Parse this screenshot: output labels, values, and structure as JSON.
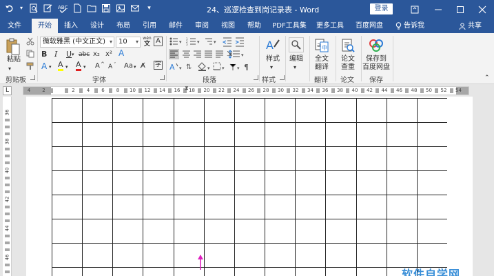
{
  "titlebar": {
    "doc_title": "24、巡逻检查到岗记录表 - Word",
    "login_label": "登录",
    "qat_icons": [
      "undo-icon",
      "redo-icon",
      "print-preview-icon",
      "format-painter-icon",
      "spellcheck-icon",
      "new-doc-icon",
      "open-folder-icon",
      "save-icon",
      "photo-icon",
      "email-icon",
      "qat-more-icon"
    ]
  },
  "tabs": {
    "items": [
      {
        "label": "文件"
      },
      {
        "label": "开始"
      },
      {
        "label": "插入"
      },
      {
        "label": "设计"
      },
      {
        "label": "布局"
      },
      {
        "label": "引用"
      },
      {
        "label": "邮件"
      },
      {
        "label": "审阅"
      },
      {
        "label": "视图"
      },
      {
        "label": "帮助"
      },
      {
        "label": "PDF工具集"
      },
      {
        "label": "更多工具"
      },
      {
        "label": "百度网盘"
      }
    ],
    "active": "开始",
    "tell_me": "告诉我",
    "share": "共享"
  },
  "ribbon": {
    "clipboard": {
      "paste_label": "粘贴",
      "group_label": "剪贴板"
    },
    "font": {
      "font_name": "微软雅黑 (中文正文)",
      "font_size": "10",
      "group_label": "字体",
      "buttons": {
        "bold": "B",
        "italic": "I",
        "underline": "U",
        "strike": "abc",
        "subscript": "x₂",
        "superscript": "x²",
        "clear": "A",
        "highlight": "A",
        "color": "A",
        "grow": "A",
        "shrink": "A",
        "case": "Aa",
        "phonetic": "wén"
      }
    },
    "paragraph": {
      "group_label": "段落"
    },
    "styles": {
      "styles_label": "样式",
      "group_label": "样式"
    },
    "editing": {
      "editing_label": "编辑"
    },
    "translate": {
      "line1": "全文",
      "line2": "翻译",
      "group_label": "翻译"
    },
    "paper": {
      "line1": "论文",
      "line2": "查重",
      "group_label": "论文"
    },
    "save": {
      "line1": "保存到",
      "line2": "百度网盘",
      "group_label": "保存"
    }
  },
  "ruler": {
    "labels": [
      "4",
      "2",
      "",
      "2",
      "4",
      "6",
      "8",
      "10",
      "12",
      "14",
      "16",
      "18",
      "20",
      "22",
      "24",
      "26",
      "28",
      "30",
      "32",
      "34",
      "36",
      "38",
      "40",
      "42",
      "44",
      "46",
      "48",
      "50",
      "52",
      "54"
    ],
    "corner": "L"
  },
  "vruler": {
    "labels": [
      "36",
      "38",
      "40",
      "42",
      "44",
      "46"
    ]
  },
  "document": {
    "table": {
      "rows": 7,
      "cols": 13
    },
    "watermark": "软件自学网"
  }
}
